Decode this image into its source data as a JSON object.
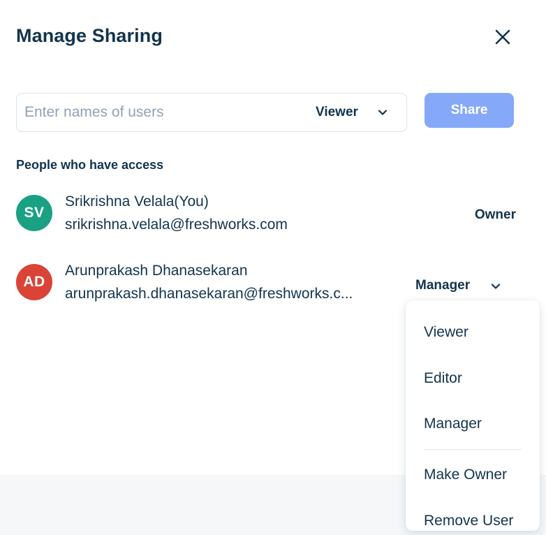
{
  "dialog": {
    "title": "Manage Sharing"
  },
  "invite": {
    "placeholder": "Enter names of users",
    "value": "",
    "role_label": "Viewer",
    "share_label": "Share"
  },
  "access": {
    "heading": "People who have access",
    "people": [
      {
        "initials": "SV",
        "avatar_color": "#1aa183",
        "name": "Srikrishna Velala(You)",
        "email": "srikrishna.velala@freshworks.com",
        "role": "Owner"
      },
      {
        "initials": "AD",
        "avatar_color": "#d94436",
        "name": "Arunprakash Dhanasekaran",
        "email": "arunprakash.dhanasekaran@freshworks.c...",
        "role": "Manager"
      }
    ]
  },
  "role_menu": {
    "items": [
      "Viewer",
      "Editor",
      "Manager"
    ],
    "actions": [
      "Make Owner",
      "Remove User"
    ]
  },
  "colors": {
    "text": "#12344d",
    "share_button": "#85a9f8",
    "placeholder": "#92a2b1"
  },
  "icons": {
    "close": "close-icon",
    "dropdown": "chevron-down-icon"
  }
}
